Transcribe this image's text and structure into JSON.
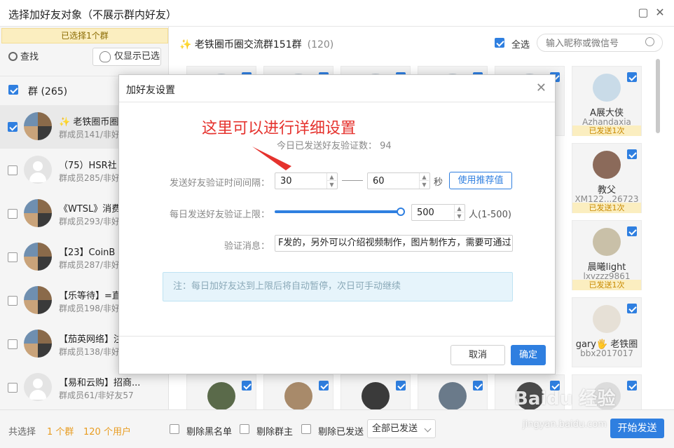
{
  "window": {
    "title": "选择加好友对象（不展示群内好友）"
  },
  "left": {
    "selected_banner": "已选择1个群",
    "search_label": "查找",
    "only_selected_label": "仅显示已选",
    "group_header": "群 (265)",
    "groups": [
      {
        "name": "✨ 老铁圈币圈",
        "sub": "群成员141/非好",
        "checked": true
      },
      {
        "name": "（75）HSR社",
        "sub": "群成员285/非好",
        "checked": false
      },
      {
        "name": "《WTSL》消费",
        "sub": "群成员293/非好",
        "checked": false
      },
      {
        "name": "【23】CoinB",
        "sub": "群成员287/非好",
        "checked": false
      },
      {
        "name": "【乐等待】=直",
        "sub": "群成员198/非好",
        "checked": false
      },
      {
        "name": "【茄英网络】注",
        "sub": "群成员138/非好",
        "checked": false
      },
      {
        "name": "【易和云购】招商...",
        "sub": "群成员61/非好友57",
        "checked": false
      }
    ]
  },
  "right": {
    "group_title": "✨ 老铁圈币圈交流群151群",
    "group_count": "(120)",
    "select_all_label": "全选",
    "search_placeholder": "输入昵称或微信号",
    "cards": [
      {
        "name": "A展大侠",
        "id": "Azhandaxia",
        "sent": "已发送1次"
      },
      {
        "name": "教父",
        "id": "XM122...26723",
        "sent": "已发送1次"
      },
      {
        "name": "晨曦light",
        "id": "lxvzzz9861",
        "sent": "已发送1次"
      },
      {
        "name": "gary🖐 老铁圈",
        "id": "bbx2017017",
        "sent": ""
      }
    ]
  },
  "bottom": {
    "total_label": "共选择",
    "group_count": "1 个群",
    "user_count": "120 个用户",
    "remove_blacklist": "剔除黑名单",
    "remove_owner": "剔除群主",
    "remove_sent": "剔除已发送",
    "dropdown_value": "全部已发送",
    "start_button": "开始发送"
  },
  "dialog": {
    "title": "加好友设置",
    "annotation": "这里可以进行详细设置",
    "today_sent": "今日已发送好友验证数： 94",
    "interval_label": "发送好友验证时间间隔：",
    "interval_min": "30",
    "interval_max": "60",
    "seconds_unit": "秒",
    "recommend_button": "使用推荐值",
    "daily_limit_label": "每日发送好友验证上限：",
    "daily_limit_value": "500",
    "daily_limit_range": "人(1-500)",
    "daily_limit_fraction": 1.0,
    "message_label": "验证消息：",
    "message_value": "F发的，另外可以介绍视频制作，图片制作方，需要可通过",
    "note": "注：每日加好友达到上限后将自动暂停，次日可手动继续",
    "cancel_button": "取消",
    "ok_button": "确定"
  },
  "watermark": {
    "logo": "Baidu 经验",
    "url": "jingyan.baidu.com"
  },
  "colors": {
    "accent": "#2f7fe0",
    "highlight": "#e89c20",
    "annotation": "#e5322d",
    "banner": "#fbeec0"
  }
}
